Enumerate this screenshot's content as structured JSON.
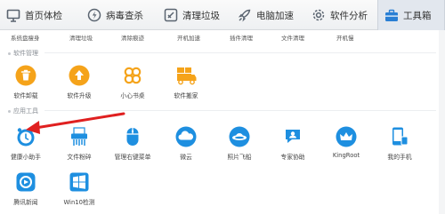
{
  "nav": {
    "tabs": [
      {
        "label": "首页体检",
        "icon": "monitor-icon"
      },
      {
        "label": "病毒查杀",
        "icon": "shield-bolt-icon"
      },
      {
        "label": "清理垃圾",
        "icon": "broom-icon"
      },
      {
        "label": "电脑加速",
        "icon": "rocket-icon"
      },
      {
        "label": "软件分析",
        "icon": "gear-icon"
      },
      {
        "label": "工具箱",
        "icon": "toolbox-icon"
      }
    ],
    "active_index": 5
  },
  "top_tools": [
    "系统盘瘦身",
    "清理垃圾",
    "清除痕迹",
    "开机加速",
    "插件清理",
    "文件清理",
    "开机慢"
  ],
  "sections": {
    "software": {
      "title": "软件管理",
      "items": [
        {
          "label": "软件卸载",
          "icon": "trash-icon",
          "color": "#f5a31a"
        },
        {
          "label": "软件升级",
          "icon": "upload-arrow-icon",
          "color": "#f5a31a"
        },
        {
          "label": "小心书桌",
          "icon": "clover-icon",
          "color": "#f5a31a"
        },
        {
          "label": "软件搬家",
          "icon": "truck-icon",
          "color": "#f5a31a"
        }
      ]
    },
    "apps": {
      "title": "应用工具",
      "items": [
        {
          "label": "健康小助手",
          "icon": "alarm-clock-icon",
          "color": "#1e8fe0"
        },
        {
          "label": "文件粉碎",
          "icon": "shredder-icon",
          "color": "#1e8fe0"
        },
        {
          "label": "管理右键菜单",
          "icon": "mouse-icon",
          "color": "#1e8fe0"
        },
        {
          "label": "微云",
          "icon": "cloud-icon",
          "color": "#1e8fe0"
        },
        {
          "label": "照片飞船",
          "icon": "ufo-icon",
          "color": "#1e8fe0"
        },
        {
          "label": "专家协助",
          "icon": "expert-icon",
          "color": "#1e8fe0"
        },
        {
          "label": "KingRoot",
          "icon": "crown-icon",
          "color": "#1e8fe0"
        },
        {
          "label": "我的手机",
          "icon": "phone-icon",
          "color": "#1e8fe0"
        },
        {
          "label": "腾讯新闻",
          "icon": "news-icon",
          "color": "#1e8fe0"
        },
        {
          "label": "Win10检测",
          "icon": "windows-icon",
          "color": "#1e8fe0"
        }
      ]
    }
  },
  "annotation": {
    "color": "#e02020"
  }
}
